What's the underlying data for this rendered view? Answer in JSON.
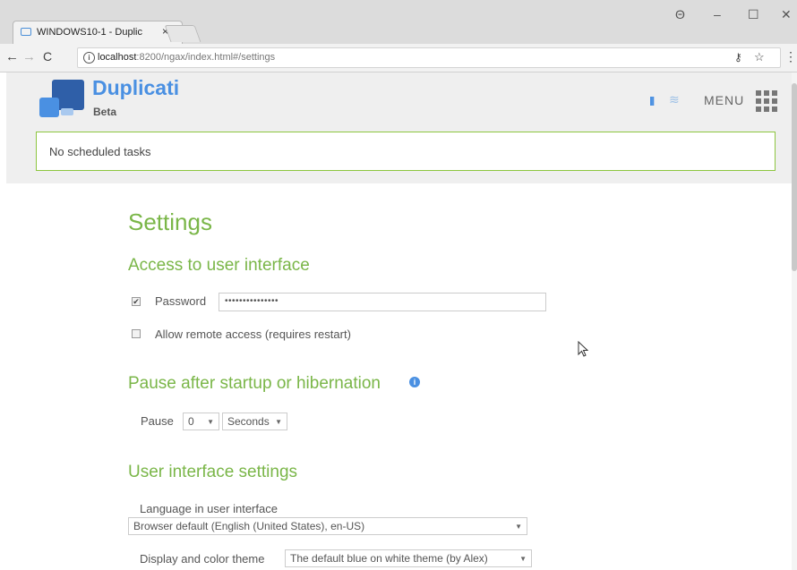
{
  "browser": {
    "tab_title": "WINDOWS10-1 - Duplic",
    "tab_close": "×",
    "url_host": "localhost",
    "url_rest": ":8200/ngax/index.html#/settings",
    "window_controls": {
      "profile": "Θ",
      "minimize": "–",
      "maximize": "☐",
      "close": "✕"
    },
    "icons": {
      "back": "←",
      "forward": "→",
      "reload": "C",
      "info": "i",
      "key": "⚷",
      "star": "☆",
      "menu": "⋮"
    }
  },
  "app": {
    "name": "Duplicati",
    "edition": "Beta",
    "menu_label": "MENU",
    "pause_icon": "II",
    "throttle_icon": "≋",
    "status": "No scheduled tasks",
    "brand_color": "#4a90e2",
    "accent_color": "#7ab648"
  },
  "settings": {
    "title": "Settings",
    "access": {
      "heading": "Access to user interface",
      "password_label": "Password",
      "password_checked": true,
      "password_value": "•••••••••••••••",
      "remote_label": "Allow remote access (requires restart)",
      "remote_checked": false
    },
    "pause": {
      "heading": "Pause after startup or hibernation",
      "info_icon": "i",
      "label": "Pause",
      "value": "0",
      "unit": "Seconds"
    },
    "ui": {
      "heading": "User interface settings",
      "language_label": "Language in user interface",
      "language_value": "Browser default (English (United States), en-US)",
      "theme_label": "Display and color theme",
      "theme_value": "The default blue on white theme (by Alex)"
    }
  }
}
